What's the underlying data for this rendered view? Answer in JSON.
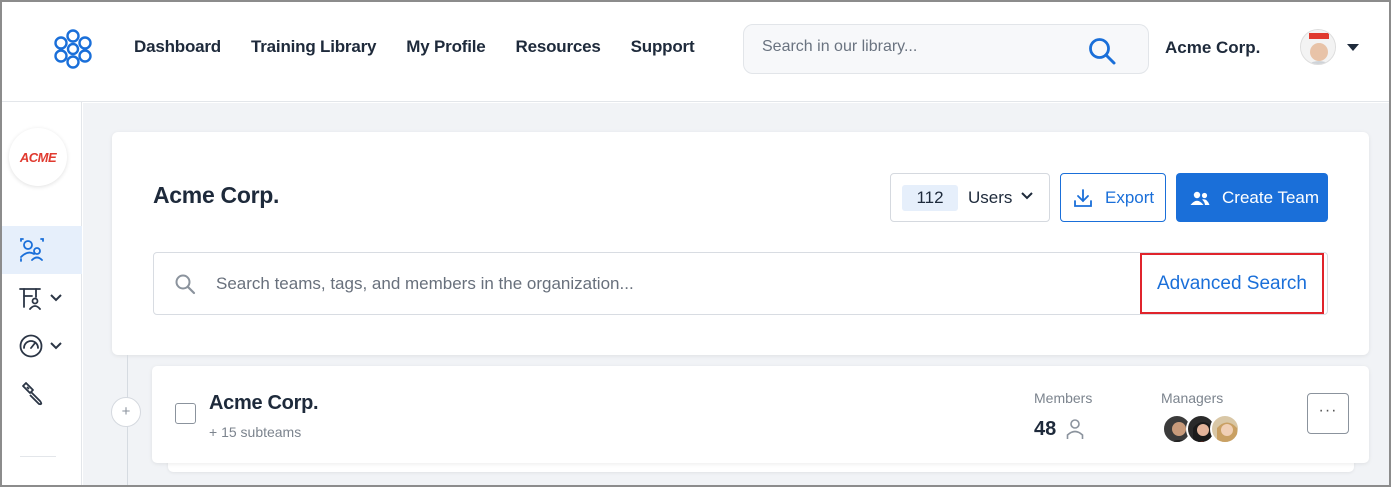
{
  "topbar": {
    "logo": "network-logo",
    "nav": [
      "Dashboard",
      "Training Library",
      "My Profile",
      "Resources",
      "Support"
    ],
    "search_placeholder": "Search in our library...",
    "company": "Acme Corp."
  },
  "sidebar": {
    "org_logo_text": "ACME",
    "items": [
      {
        "icon": "users-icon",
        "active": true
      },
      {
        "icon": "teacher-icon",
        "has_dropdown": true
      },
      {
        "icon": "gauge-icon",
        "has_dropdown": true
      },
      {
        "icon": "brush-icon"
      }
    ]
  },
  "org": {
    "title": "Acme Corp.",
    "users_count": "112",
    "users_label": "Users",
    "export_label": "Export",
    "create_team_label": "Create Team",
    "search_placeholder": "Search teams, tags, and members in the organization...",
    "advanced_search_label": "Advanced Search"
  },
  "team": {
    "name": "Acme Corp.",
    "subteams": "+ 15 subteams",
    "members_label": "Members",
    "members_count": "48",
    "managers_label": "Managers",
    "more_label": "···",
    "expand_label": "+"
  },
  "colors": {
    "accent": "#1a6fd9",
    "highlight_border": "#e0242c",
    "text": "#1e2a3b"
  }
}
